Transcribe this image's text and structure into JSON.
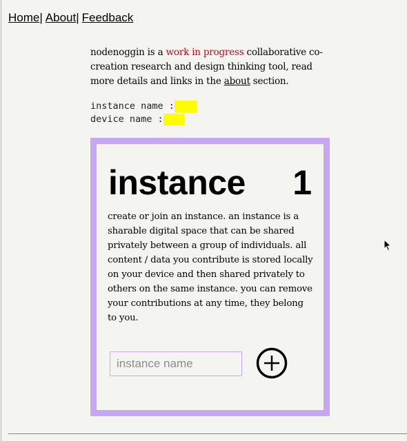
{
  "nav": {
    "items": [
      {
        "label": "Home"
      },
      {
        "label": "About"
      },
      {
        "label": "Feedback"
      }
    ],
    "separator": "|"
  },
  "intro": {
    "prefix": "nodenoggin is a ",
    "highlight": "work in progress",
    "middle": " collaborative co-creation research and design thinking tool, read more details and links in the ",
    "link": "about",
    "suffix": " section.",
    "highlight_color": "#d0021b"
  },
  "meta": {
    "instance_label": "instance name :",
    "device_label": "device name :",
    "highlight_color": "#fffd00"
  },
  "card": {
    "title": "instance",
    "number": "1",
    "description": "create or join an instance. an instance is a sharable digital space that can be shared privately between a group of individuals. all content / data you contribute is stored locally on your device and then shared privately to others on the same instance. you can remove your contributions at any time, they belong to you.",
    "input_placeholder": "instance name",
    "input_value": "",
    "add_icon": "plus-circle-icon",
    "border_color": "#c6a7f2"
  }
}
